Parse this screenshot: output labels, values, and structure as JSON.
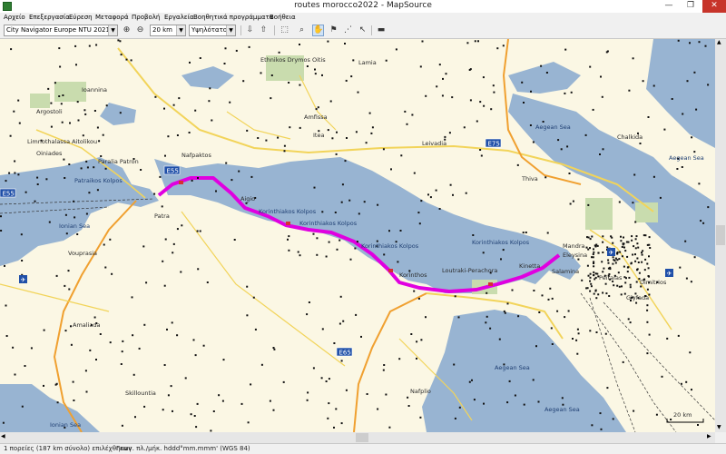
{
  "window": {
    "title": "routes morocco2022 - MapSource",
    "minimize": "—",
    "maximize": "❐",
    "close": "✕"
  },
  "menu": [
    "Αρχείο",
    "Επεξεργασία",
    "Εύρεση",
    "Μεταφορά",
    "Προβολή",
    "Εργαλεία",
    "Βοηθητικά προγράμματα",
    "Βοήθεια"
  ],
  "toolbar": {
    "product": "City Navigator Europe NTU 2021.1",
    "zoom": "20 km",
    "detail": "Υψηλότατο",
    "icons": [
      "zoom-in-icon",
      "zoom-out-icon",
      "receive-from-device-icon",
      "send-to-device-icon",
      "selection-tool-icon",
      "zoom-tool-icon",
      "hand-tool-icon",
      "waypoint-tool-icon",
      "route-tool-icon",
      "pointer-tool-icon",
      "measure-tool-icon"
    ]
  },
  "map": {
    "labels": {
      "ioannina": "Ioannina",
      "argostoli": "Argostoli",
      "limnothalassa": "Limnothalassa Aitolikou",
      "oiniades": "Oiniades",
      "patra": "Patra",
      "paraliapatras": "Paralia Patron",
      "patraikos": "Patraikos Kolpos",
      "nafpaktos": "Nafpaktos",
      "aigio": "Aigio",
      "korinthiakos1": "Korinthiakos Kolpos",
      "korinthiakos2": "Korinthiakos Kolpos",
      "korinthiakos3": "Korinthiakos Kolpos",
      "korinthiakos4": "Korinthiakos Kolpos",
      "ioniansea1": "Ionian Sea",
      "ioniansea2": "Ionian Sea",
      "vouprasia": "Vouprasia",
      "amaliada": "Amaliada",
      "skillountia": "Skillountia",
      "lamia": "Lamia",
      "leivadia": "Leivadia",
      "thiva": "Thiva",
      "aegean1": "Aegean Sea",
      "aegean2": "Aegean Sea",
      "aegean3": "Aegean Sea",
      "aegean4": "Aegean Sea",
      "chalkida": "Chalkida",
      "mandra": "Mandra",
      "eleysina": "Eleysina",
      "salamina": "Salamina",
      "peiraias": "Peiraias",
      "dimitrios": "Dimitrios",
      "glyfada": "Glyfada",
      "korinthos": "Korinthos",
      "loutraki": "Loutraki-Perachora",
      "kinetta": "Kinetta",
      "nafplio": "Nafplio",
      "ethnikos": "Ethnikos Drymos Oitis",
      "amfissa": "Amfissa",
      "itea": "Itea"
    },
    "roads": {
      "e55a": "E55",
      "e55b": "E55",
      "e75": "E75",
      "e65": "E65"
    },
    "scale": "20 km",
    "colors": {
      "land": "#fbf7e4",
      "sea": "#98b4d2",
      "route": "#e000e0",
      "park": "#c9dcae",
      "road_yellow": "#f2d45a",
      "road_orange": "#f0a030",
      "shield": "#1f4fa8"
    }
  },
  "status": {
    "left": "1 πορείες (187 km σύνολο) επιλέχθηκαν",
    "right": "Γεωγ. πλ./μήκ. hddd°mm.mmm' (WGS 84)"
  }
}
